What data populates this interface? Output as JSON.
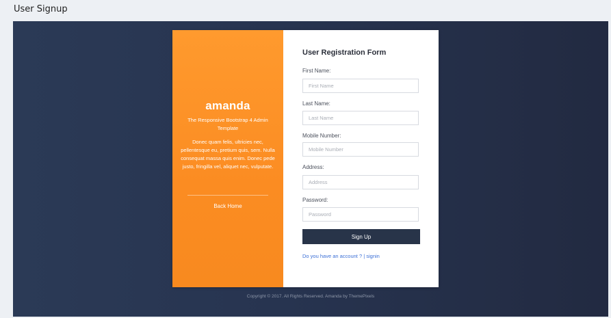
{
  "page": {
    "heading": "User Signup"
  },
  "brand": {
    "name": "amanda",
    "tagline": "The Responsive Bootstrap 4 Admin Template",
    "description": "Donec quam felis, ultricies nec, pellentesque eu, pretium quis, sem. Nulla consequat massa quis enim. Donec pede justo, fringilla vel, aliquet nec, vulputate.",
    "back_home_label": "Back Home"
  },
  "form": {
    "title": "User Registration Form",
    "fields": {
      "first_name": {
        "label": "First Name:",
        "placeholder": "First Name",
        "value": ""
      },
      "last_name": {
        "label": "Last Name:",
        "placeholder": "Last Name",
        "value": ""
      },
      "mobile": {
        "label": "Mobile Number:",
        "placeholder": "Mobile Number",
        "value": ""
      },
      "address": {
        "label": "Address:",
        "placeholder": "Address",
        "value": ""
      },
      "password": {
        "label": "Password:",
        "placeholder": "Password",
        "value": ""
      }
    },
    "submit_label": "Sign Up",
    "signin_text": "Do you have an account ? | signin"
  },
  "footer": {
    "copyright": "Copyright © 2017. All Rights Reserved. Amanda by ThemePixels"
  },
  "colors": {
    "brand_orange": "#fb8c22",
    "navy_background": "#273450",
    "button_navy": "#283449",
    "link_blue": "#3b6fd6"
  }
}
